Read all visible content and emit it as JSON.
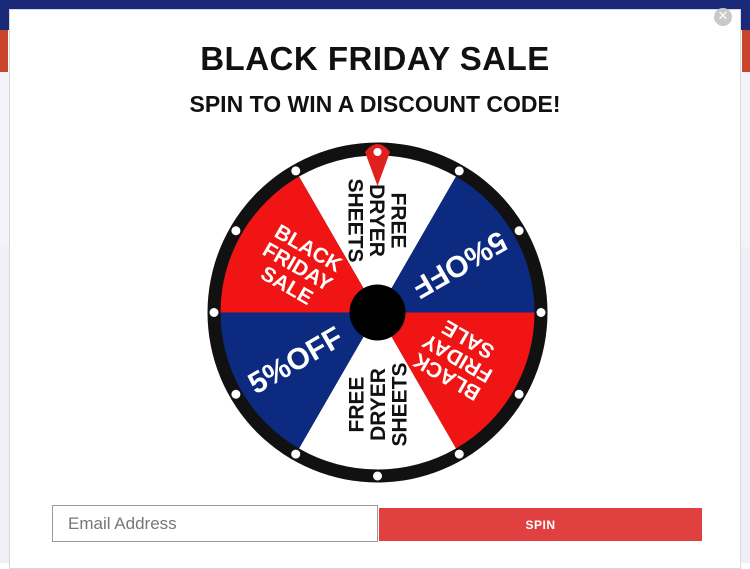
{
  "popup": {
    "title": "BLACK FRIDAY SALE",
    "subtitle": "SPIN TO WIN A DISCOUNT CODE!",
    "close_icon": "close-icon",
    "email_placeholder": "Email Address",
    "email_value": "",
    "spin_label": "SPIN"
  },
  "wheel": {
    "segments": [
      {
        "label": [
          "FREE",
          "DRYER",
          "SHEETS"
        ],
        "color": "#ffffff",
        "text_color": "#111111"
      },
      {
        "label": [
          "5%OFF"
        ],
        "color": "#0c2a80",
        "text_color": "#ffffff"
      },
      {
        "label": [
          "BLACK",
          "FRIDAY",
          "SALE"
        ],
        "color": "#f01414",
        "text_color": "#ffffff"
      },
      {
        "label": [
          "FREE",
          "DRYER",
          "SHEETS"
        ],
        "color": "#ffffff",
        "text_color": "#111111"
      },
      {
        "label": [
          "5%OFF"
        ],
        "color": "#0c2a80",
        "text_color": "#ffffff"
      },
      {
        "label": [
          "BLACK",
          "FRIDAY",
          "SALE"
        ],
        "color": "#f01414",
        "text_color": "#ffffff"
      }
    ],
    "rim_color": "#111111",
    "hub_color": "#000000",
    "pointer_color": "#e0201c",
    "dot_color": "#ffffff"
  },
  "colors": {
    "brand_blue": "#1b2a78",
    "spin_red": "#e0403f"
  }
}
